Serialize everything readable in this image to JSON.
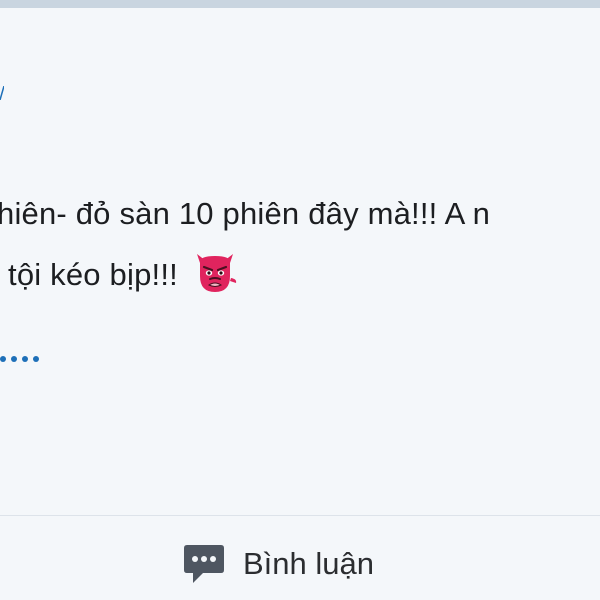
{
  "post": {
    "line_1": "hiên- đỏ sàn 10 phiên đây mà!!! A n",
    "line_2": "tội kéo bịp!!!",
    "emoji": "red-goblin-face-icon",
    "more": "…"
  },
  "actions": {
    "comment_label": "Bình luận",
    "comment_icon": "speech-bubble-icon"
  },
  "colors": {
    "background": "#f4f7fa",
    "text": "#1c1e21",
    "link": "#1d6fb8",
    "icon": "#4e5661",
    "emoji": "#e0245e"
  }
}
